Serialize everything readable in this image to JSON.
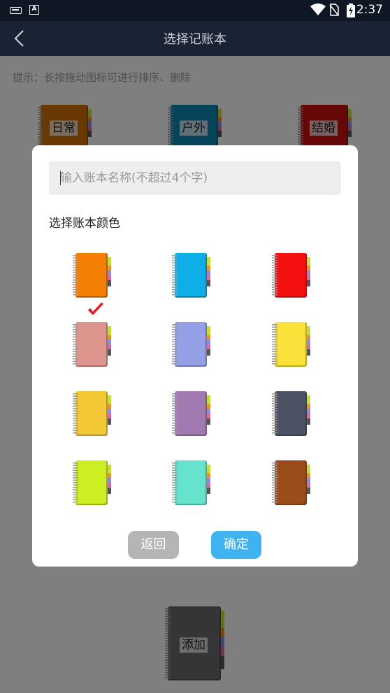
{
  "status_bar": {
    "time": "2:37",
    "app_badge": "A"
  },
  "header": {
    "title": "选择记账本"
  },
  "hint": "提示：长按拖动图标可进行排序、删除",
  "books": [
    {
      "label": "日常",
      "color": "#d36e00"
    },
    {
      "label": "户外",
      "color": "#0c89b8"
    },
    {
      "label": "结婚",
      "color": "#cf1111"
    }
  ],
  "add_book": {
    "label": "添加",
    "color": "#6b6b6b"
  },
  "dialog": {
    "name_placeholder": "输入账本名称(不超过4个字)",
    "color_label": "选择账本颜色",
    "colors": [
      {
        "name": "orange",
        "hex": "#f57e05",
        "selected": false
      },
      {
        "name": "sky-blue",
        "hex": "#0eaee9",
        "selected": false
      },
      {
        "name": "red",
        "hex": "#f51010",
        "selected": false
      },
      {
        "name": "dusty-pink",
        "hex": "#de958e",
        "selected": true
      },
      {
        "name": "periwinkle",
        "hex": "#949fe6",
        "selected": false
      },
      {
        "name": "yellow",
        "hex": "#fbe23a",
        "selected": false
      },
      {
        "name": "gold",
        "hex": "#f4c834",
        "selected": false
      },
      {
        "name": "purple",
        "hex": "#a27ab2",
        "selected": false
      },
      {
        "name": "slate",
        "hex": "#4b5263",
        "selected": false
      },
      {
        "name": "lime",
        "hex": "#cbef22",
        "selected": false
      },
      {
        "name": "mint",
        "hex": "#66e3cc",
        "selected": false
      },
      {
        "name": "brown",
        "hex": "#9a4c1b",
        "selected": false
      }
    ],
    "buttons": {
      "back": "返回",
      "confirm": "确定"
    },
    "check_color": "#e01b1b"
  }
}
